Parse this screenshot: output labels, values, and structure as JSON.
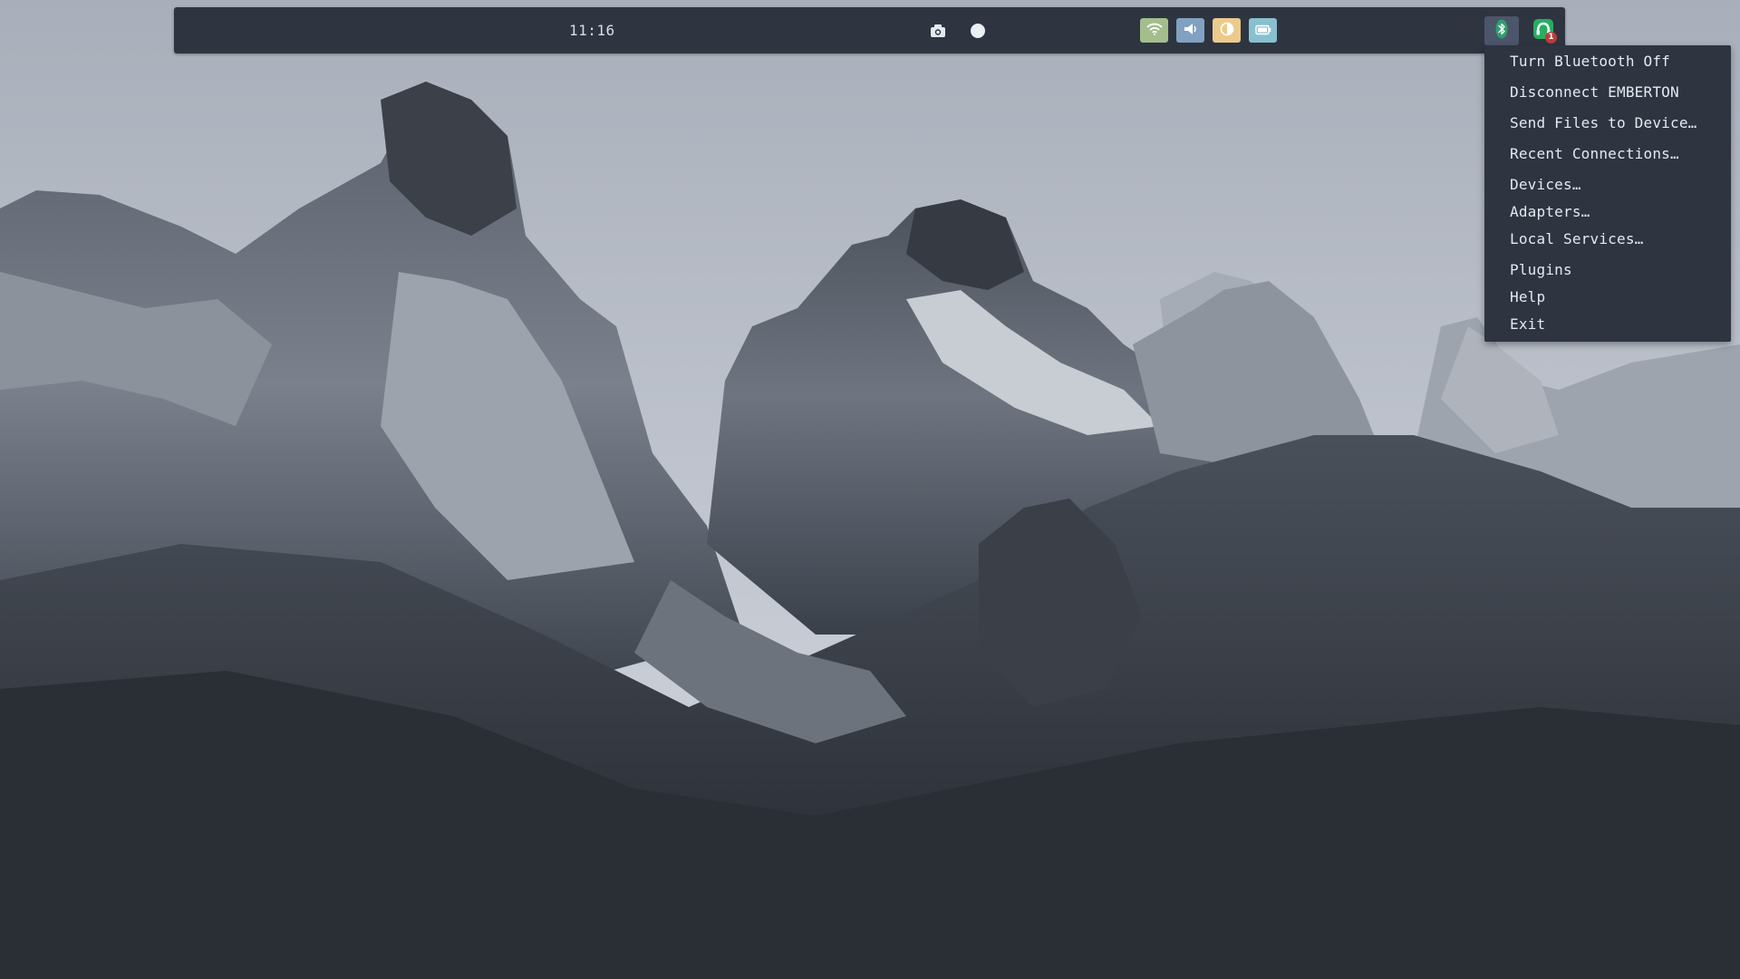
{
  "topbar": {
    "clock": "11:16",
    "center_icons": [
      "camera-icon",
      "record-icon"
    ],
    "status_chips": [
      {
        "icon": "wifi-icon",
        "color": "#a3be8c"
      },
      {
        "icon": "volume-icon",
        "color": "#81a1c1"
      },
      {
        "icon": "brightness-icon",
        "color": "#ebcb8b"
      },
      {
        "icon": "battery-icon",
        "color": "#88c0d0"
      }
    ],
    "tray": [
      {
        "icon": "bluetooth-icon",
        "color": "#2f9e6e"
      },
      {
        "icon": "notification-icon",
        "color": "#27ae60",
        "badge": "1"
      }
    ]
  },
  "bluetooth_menu": {
    "items": [
      "Turn Bluetooth Off",
      "Disconnect EMBERTON",
      "Send Files to Device…",
      "Recent Connections…",
      "Devices…",
      "Adapters…",
      "Local Services…",
      "Plugins",
      "Help",
      "Exit"
    ]
  },
  "colors": {
    "bar_bg": "#2e3440",
    "text": "#d8dee9",
    "accent_green": "#a3be8c",
    "accent_blue": "#81a1c1",
    "accent_yellow": "#ebcb8b",
    "accent_cyan": "#88c0d0"
  }
}
